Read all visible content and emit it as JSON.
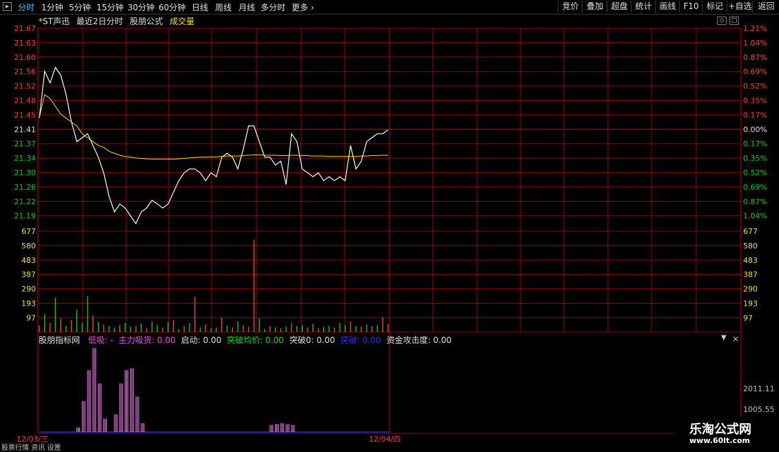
{
  "toolbar": {
    "period_tabs": [
      "分时",
      "1分钟",
      "5分钟",
      "15分钟",
      "30分钟",
      "60分钟",
      "日线",
      "周线",
      "月线",
      "多分时",
      "更多"
    ],
    "active_tab": "分时",
    "right_buttons": [
      "竞价",
      "叠加",
      "超盘",
      "统计",
      "画线",
      "F10",
      "标记",
      "+自选",
      "返回"
    ]
  },
  "header": {
    "stock": "*ST声迅",
    "view": "最近2日分时",
    "formula": "股朋公式",
    "volume_label": "成交量"
  },
  "indicator": {
    "name": "股朋指标网",
    "items": [
      {
        "text": "低吸: -",
        "color": "#ff40ff"
      },
      {
        "text": "主力吸货: 0.00",
        "color": "#ff40ff"
      },
      {
        "text": "启动: 0.00",
        "color": "#e0e0e0"
      },
      {
        "text": "突破均价: 0.00",
        "color": "#00e000"
      },
      {
        "text": "突破0: 0.00",
        "color": "#e0e0e0"
      },
      {
        "text": "突破: 0.00",
        "color": "#3030ff"
      },
      {
        "text": "资金攻击度: 0.00",
        "color": "#e0e0e0"
      }
    ],
    "axis_labels": [
      "2011.11",
      "1005.55"
    ]
  },
  "watermark": {
    "title": "乐淘公式网",
    "url": "www.60lt.com"
  },
  "footer_text": "股票行情 资讯 设置",
  "colors": {
    "grid": "#a00000",
    "up": "#ff3b3b",
    "down": "#00d000",
    "price": "#ffffff",
    "avg": "#f0e030",
    "pink": "#ff80ff",
    "blue": "#2040ff"
  },
  "chart_data": {
    "type": "line",
    "price_axis_left": [
      "21.67",
      "21.63",
      "21.60",
      "21.56",
      "21.52",
      "21.48",
      "21.45",
      "21.41",
      "21.37",
      "21.34",
      "21.30",
      "21.26",
      "21.22",
      "21.19"
    ],
    "price_axis_right": [
      "1.21%",
      "1.04%",
      "0.87%",
      "0.69%",
      "0.52%",
      "0.35%",
      "0.17%",
      "0.00%",
      "0.17%",
      "0.35%",
      "0.52%",
      "0.69%",
      "0.87%",
      "1.04%"
    ],
    "volume_axis": [
      "677",
      "580",
      "483",
      "387",
      "290",
      "193",
      "97"
    ],
    "dates": [
      "12/03/三",
      "12/04/四"
    ],
    "prev_close": 21.41,
    "ylim": [
      21.19,
      21.67
    ],
    "series": [
      {
        "name": "price",
        "values": [
          21.44,
          21.56,
          21.53,
          21.57,
          21.55,
          21.5,
          21.43,
          21.38,
          21.39,
          21.4,
          21.37,
          21.34,
          21.3,
          21.24,
          21.2,
          21.22,
          21.21,
          21.19,
          21.17,
          21.2,
          21.21,
          21.23,
          21.22,
          21.21,
          21.22,
          21.25,
          21.28,
          21.3,
          21.31,
          21.31,
          21.3,
          21.28,
          21.3,
          21.29,
          21.34,
          21.35,
          21.34,
          21.31,
          21.36,
          21.42,
          21.42,
          21.38,
          21.34,
          21.34,
          21.32,
          21.33,
          21.27,
          21.4,
          21.38,
          21.31,
          21.3,
          21.29,
          21.3,
          21.28,
          21.29,
          21.28,
          21.29,
          21.28,
          21.37,
          21.31,
          21.33,
          21.38,
          21.39,
          21.4,
          21.4,
          21.41
        ]
      },
      {
        "name": "avg",
        "values": [
          21.44,
          21.5,
          21.49,
          21.47,
          21.45,
          21.44,
          21.43,
          21.42,
          21.4,
          21.39,
          21.38,
          21.37,
          21.365,
          21.355,
          21.35,
          21.345,
          21.342,
          21.34,
          21.338,
          21.337,
          21.336,
          21.335,
          21.335,
          21.335,
          21.335,
          21.335,
          21.336,
          21.337,
          21.338,
          21.339,
          21.34,
          21.34,
          21.341,
          21.341,
          21.342,
          21.343,
          21.343,
          21.343,
          21.344,
          21.345,
          21.346,
          21.346,
          21.345,
          21.345,
          21.345,
          21.344,
          21.344,
          21.345,
          21.345,
          21.344,
          21.344,
          21.343,
          21.343,
          21.343,
          21.342,
          21.342,
          21.342,
          21.342,
          21.342,
          21.342,
          21.343,
          21.343,
          21.344,
          21.344,
          21.345,
          21.345
        ]
      }
    ],
    "volume": [
      45,
      120,
      60,
      230,
      90,
      40,
      80,
      150,
      60,
      240,
      110,
      70,
      50,
      40,
      30,
      45,
      60,
      35,
      40,
      55,
      25,
      70,
      45,
      30,
      65,
      80,
      20,
      40,
      60,
      235,
      30,
      50,
      25,
      30,
      95,
      40,
      30,
      70,
      45,
      35,
      620,
      90,
      20,
      40,
      30,
      25,
      35,
      60,
      40,
      45,
      30,
      55,
      25,
      35,
      40,
      30,
      60,
      45,
      70,
      40,
      35,
      50,
      40,
      45,
      100,
      55
    ],
    "volume_up": [
      true,
      false,
      true,
      false,
      true,
      false,
      true,
      false,
      false,
      false,
      true,
      false,
      true,
      false,
      false,
      true,
      false,
      false,
      true,
      false,
      true,
      false,
      false,
      true,
      false,
      true,
      false,
      true,
      false,
      true,
      false,
      true,
      false,
      false,
      true,
      false,
      true,
      false,
      true,
      true,
      true,
      false,
      false,
      true,
      false,
      true,
      false,
      true,
      false,
      false,
      true,
      false,
      true,
      false,
      false,
      true,
      false,
      false,
      true,
      false,
      true,
      false,
      true,
      false,
      true,
      true
    ],
    "indicator_pink": [
      [
        7,
        0.05
      ],
      [
        8,
        0.35
      ],
      [
        9,
        0.7
      ],
      [
        10,
        0.95
      ],
      [
        11,
        0.55
      ],
      [
        12,
        0.15
      ],
      [
        14,
        0.2
      ],
      [
        15,
        0.55
      ],
      [
        16,
        0.7
      ],
      [
        17,
        0.72
      ],
      [
        18,
        0.4
      ],
      [
        19,
        0.1
      ],
      [
        43,
        0.08
      ],
      [
        44,
        0.09
      ],
      [
        45,
        0.1
      ],
      [
        46,
        0.09
      ],
      [
        47,
        0.08
      ]
    ]
  }
}
